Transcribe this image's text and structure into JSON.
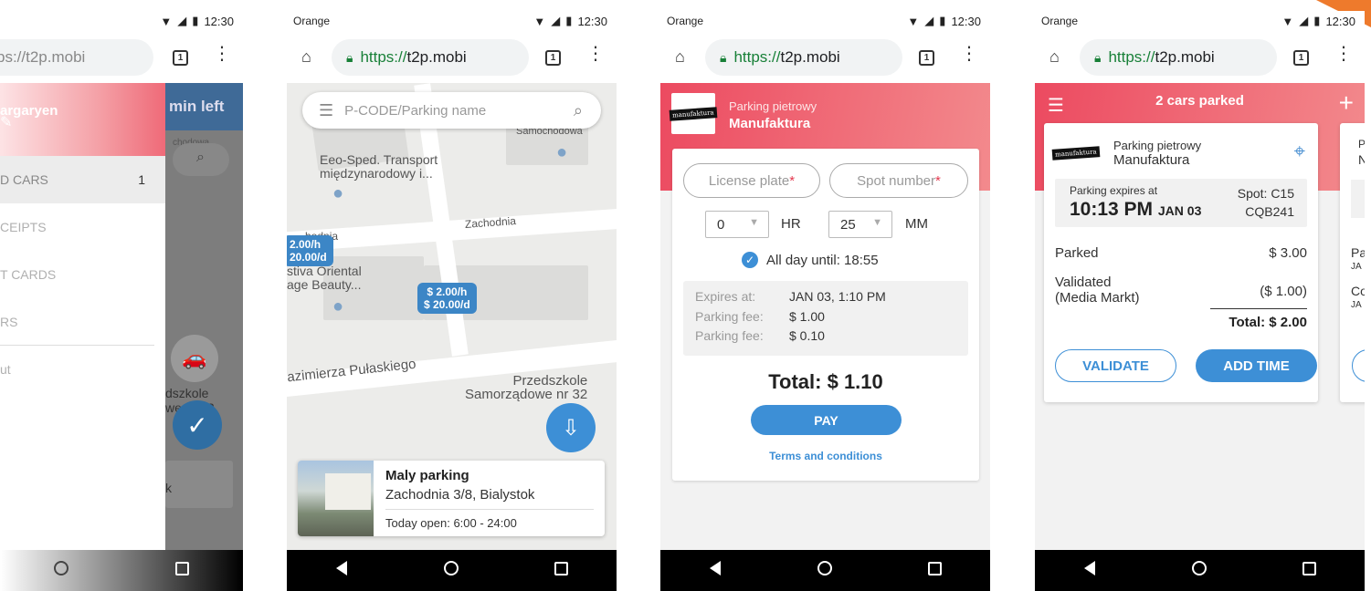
{
  "status": {
    "carrier": "Orange",
    "time": "12:30"
  },
  "browser": {
    "scheme": "https://",
    "host": "t2p.mobi",
    "partial_url": "ps://t2p.mobi",
    "tabs": "1"
  },
  "phone1": {
    "drawer_name": "argaryen",
    "menu": [
      {
        "label": "D CARS",
        "count": "1"
      },
      {
        "label": "CEIPTS"
      },
      {
        "label": "T CARDS"
      },
      {
        "label": "RS"
      },
      {
        "label": "ut"
      }
    ],
    "banner": "min left",
    "map_label_1": "chodowa",
    "map_label_2": "dszkole",
    "map_label_3": "we nr 32",
    "card_text": "k"
  },
  "phone2": {
    "search_placeholder": "P-CODE/Parking name",
    "labels": {
      "samochodowa": "Samochodowa",
      "transport": "Eeo-Sped. Transport\nmiędzynarodowy i...",
      "zachodnia": "Zachodnia",
      "zachodnia_left": "hodnia",
      "oriental": "stiva Oriental\nage Beauty...",
      "pulaskiego": "azimierza Pułaskiego",
      "przedszkole": "Przedszkole\nSamorządowe nr 32"
    },
    "tag_left": "2.00/h\n20.00/d",
    "tag_center": "$ 2.00/h\n$ 20.00/d",
    "card": {
      "name": "Maly parking",
      "address": "Zachodnia 3/8, Bialystok",
      "hours": "Today open: 6:00 - 24:00"
    }
  },
  "phone3": {
    "parking_type": "Parking pietrowy",
    "parking_name": "Manufaktura",
    "logo_text": "manufaktura",
    "license_placeholder": "License plate",
    "spot_placeholder": "Spot number",
    "hours_value": "0",
    "hours_unit": "HR",
    "minutes_value": "25",
    "minutes_unit": "MM",
    "all_day": "All day until: 18:55",
    "summary": [
      {
        "label": "Expires at:",
        "value": "JAN 03, 1:10 PM"
      },
      {
        "label": "Parking fee:",
        "value": "$ 1.00"
      },
      {
        "label": "Parking fee:",
        "value": "$ 0.10"
      }
    ],
    "total": "Total: $ 1.10",
    "pay": "PAY",
    "terms": "Terms and conditions"
  },
  "phone4": {
    "title": "2 cars parked",
    "card": {
      "parking_type": "Parking pietrowy",
      "parking_name": "Manufaktura",
      "logo_text": "manufaktura",
      "expires_label": "Parking expires at",
      "expires_time": "10:13 PM",
      "expires_date": "JAN 03",
      "spot": "Spot: C15",
      "plate": "CQB241",
      "parked_label": "Parked",
      "parked_amount": "$ 3.00",
      "validated_label": "Validated",
      "validated_sub": "(Media Markt)",
      "validated_amount": "($ 1.00)",
      "total": "Total: $ 2.00",
      "validate": "VALIDATE",
      "add_time": "ADD TIME"
    },
    "card2_partial": {
      "a": "P",
      "b": "N",
      "c": "Pa",
      "d": "JA",
      "e": "Co",
      "f": "JA"
    }
  },
  "colors": {
    "brand_coral": "#ec4a60",
    "accent_blue": "#3d8fd6"
  }
}
